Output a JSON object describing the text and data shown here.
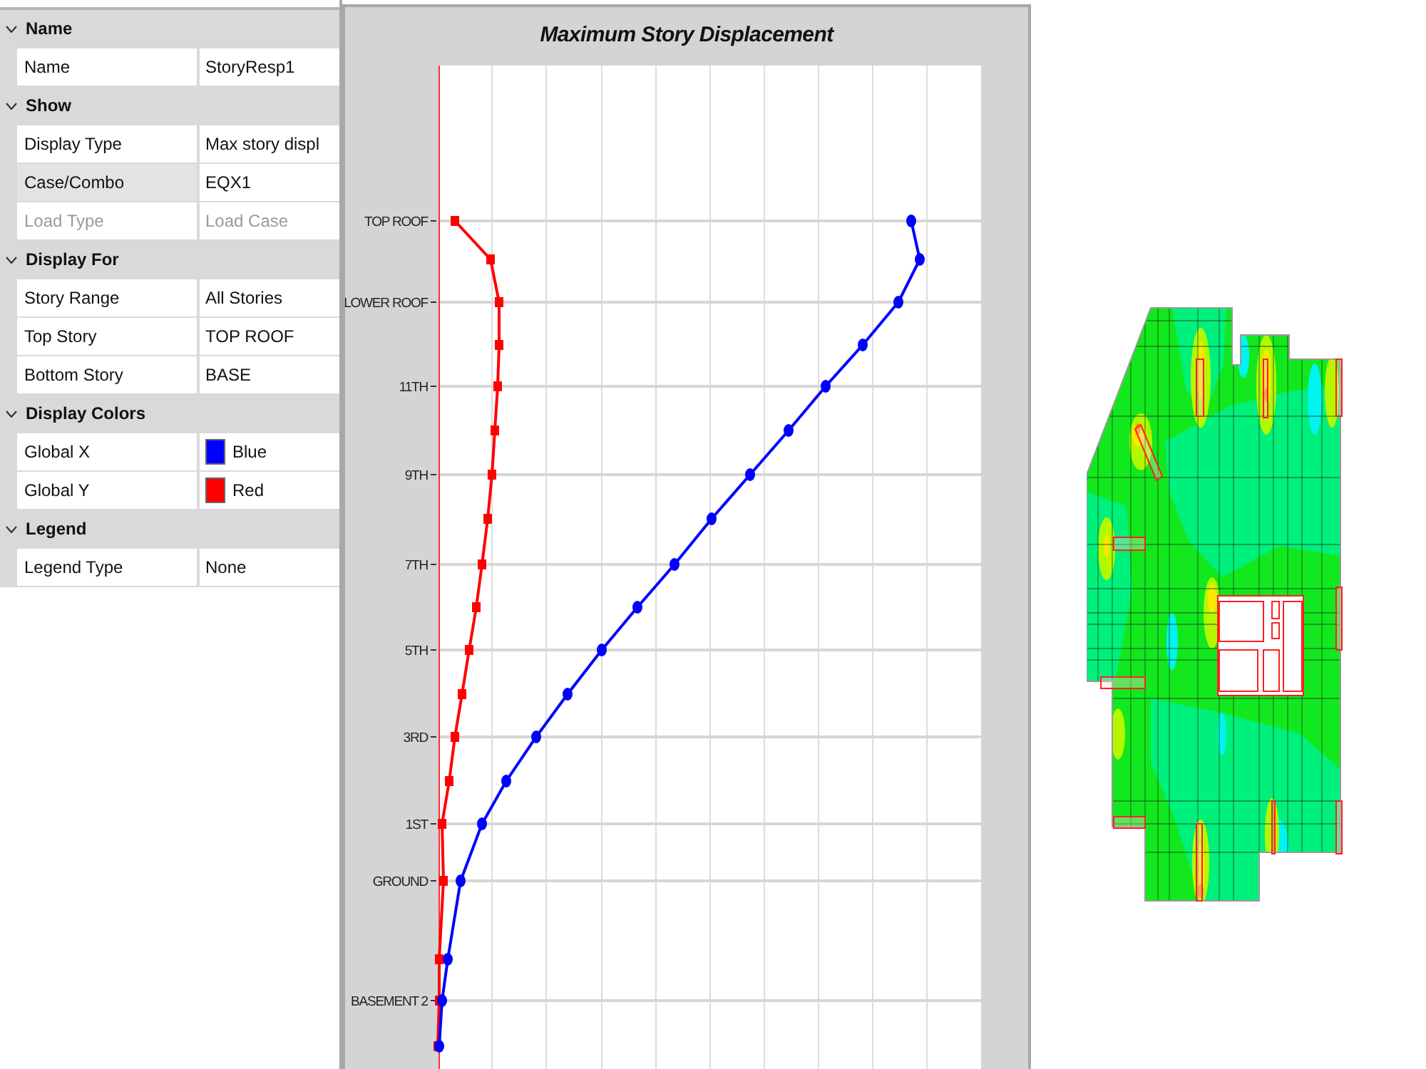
{
  "property_grid": {
    "groups": [
      {
        "title": "Name",
        "expanded": true,
        "items": [
          {
            "kind": "text",
            "label": "Name",
            "value": "StoryResp1",
            "selected": false,
            "disabled": false
          }
        ]
      },
      {
        "title": "Show",
        "expanded": true,
        "items": [
          {
            "kind": "text",
            "label": "Display Type",
            "value": "Max story displ",
            "selected": false,
            "disabled": false
          },
          {
            "kind": "text",
            "label": "Case/Combo",
            "value": "EQX1",
            "selected": true,
            "disabled": false
          },
          {
            "kind": "text",
            "label": "Load Type",
            "value": "Load Case",
            "selected": false,
            "disabled": true
          }
        ]
      },
      {
        "title": "Display For",
        "expanded": true,
        "items": [
          {
            "kind": "text",
            "label": "Story Range",
            "value": "All Stories",
            "selected": false,
            "disabled": false
          },
          {
            "kind": "text",
            "label": "Top Story",
            "value": "TOP ROOF",
            "selected": false,
            "disabled": false
          },
          {
            "kind": "text",
            "label": "Bottom Story",
            "value": "BASE",
            "selected": false,
            "disabled": false
          }
        ]
      },
      {
        "title": "Display Colors",
        "expanded": true,
        "items": [
          {
            "kind": "color",
            "label": "Global X",
            "value": "Blue",
            "color": "#0000ff",
            "selected": false,
            "disabled": false
          },
          {
            "kind": "color",
            "label": "Global Y",
            "value": "Red",
            "color": "#ff0000",
            "selected": false,
            "disabled": false
          }
        ]
      },
      {
        "title": "Legend",
        "expanded": true,
        "items": [
          {
            "kind": "text",
            "label": "Legend Type",
            "value": "None",
            "selected": false,
            "disabled": false
          }
        ]
      }
    ]
  },
  "chart": {
    "title": "Maximum Story Displacement",
    "story_labels": [
      "TOP ROOF",
      "LOWER ROOF",
      "11TH",
      "9TH",
      "7TH",
      "5TH",
      "3RD",
      "1ST",
      "GROUND",
      "BASEMENT 2"
    ]
  }
}
